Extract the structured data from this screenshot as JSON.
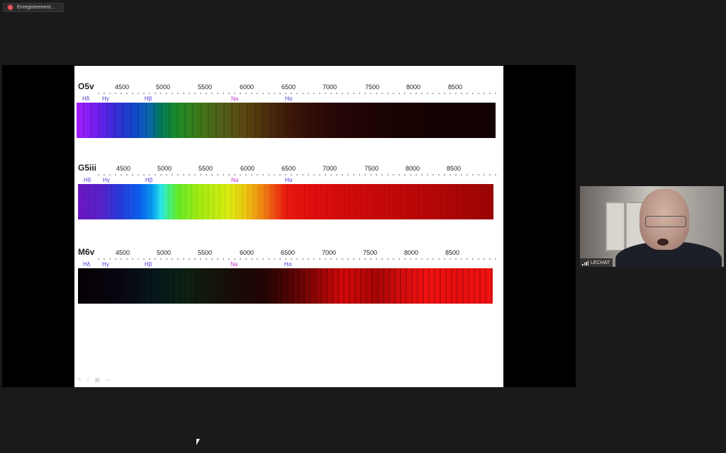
{
  "recording": {
    "label": "Enregistrement..."
  },
  "slide": {
    "ticks": [
      "4500",
      "5000",
      "5500",
      "6000",
      "6500",
      "7000",
      "7500",
      "8000",
      "8500"
    ],
    "lines": [
      {
        "label": "Hδ",
        "kind": "balmer"
      },
      {
        "label": "Hγ",
        "kind": "balmer"
      },
      {
        "label": "Hβ",
        "kind": "balmer"
      },
      {
        "label": "Na",
        "kind": "sodium"
      },
      {
        "label": "Hα",
        "kind": "balmer"
      }
    ],
    "spectra": [
      {
        "type": "O5v"
      },
      {
        "type": "G5iii"
      },
      {
        "type": "M6v"
      }
    ],
    "tools": "✎ ⁄ ▦ ⇨"
  },
  "participant": {
    "name": "LECHAT"
  },
  "colors": {
    "balmer_label": "#4a3ad8",
    "sodium_label": "#c036c0",
    "recording_dot": "#e0565b",
    "background": "#1a1a1a"
  }
}
